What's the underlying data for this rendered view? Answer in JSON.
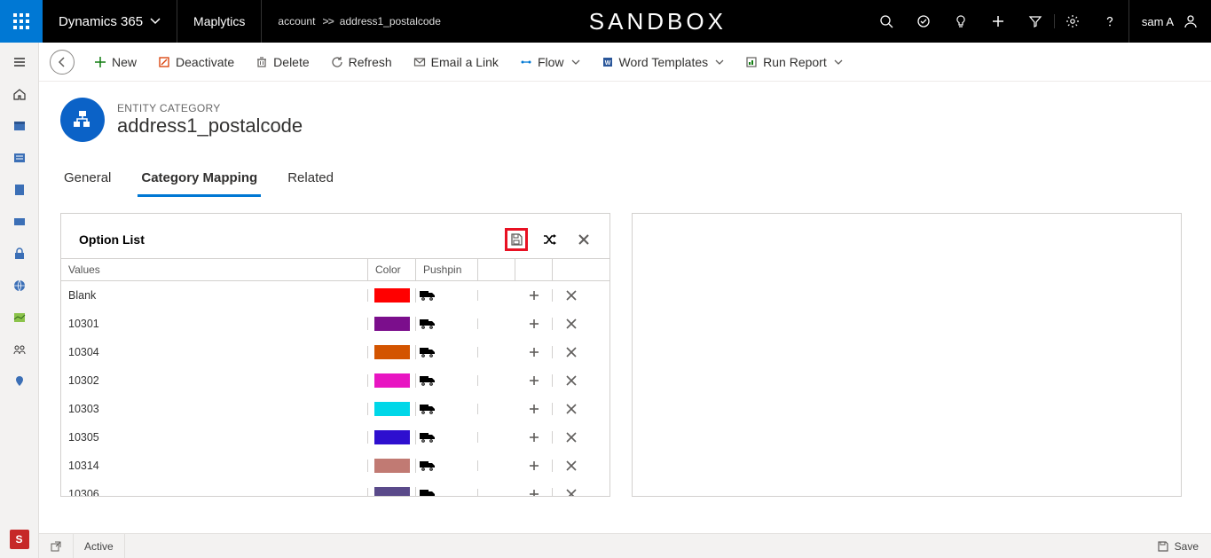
{
  "topbar": {
    "brand": "Dynamics 365",
    "app": "Maplytics",
    "breadcrumb": {
      "entity": "account",
      "field": "address1_postalcode"
    },
    "center": "SANDBOX",
    "user": "sam A"
  },
  "commands": {
    "new": "New",
    "deactivate": "Deactivate",
    "delete": "Delete",
    "refresh": "Refresh",
    "email": "Email a Link",
    "flow": "Flow",
    "word": "Word Templates",
    "report": "Run Report"
  },
  "page": {
    "category": "ENTITY CATEGORY",
    "title": "address1_postalcode"
  },
  "tabs": {
    "general": "General",
    "mapping": "Category Mapping",
    "related": "Related"
  },
  "optionlist": {
    "title": "Option List",
    "columns": {
      "values": "Values",
      "color": "Color",
      "pushpin": "Pushpin"
    },
    "rows": [
      {
        "value": "Blank",
        "color": "#ff0000"
      },
      {
        "value": "10301",
        "color": "#7b0e8c"
      },
      {
        "value": "10304",
        "color": "#d35400"
      },
      {
        "value": "10302",
        "color": "#e815c2"
      },
      {
        "value": "10303",
        "color": "#00d7e8"
      },
      {
        "value": "10305",
        "color": "#2e0fcf"
      },
      {
        "value": "10314",
        "color": "#c17a73"
      },
      {
        "value": "10306",
        "color": "#5a4a8a"
      }
    ]
  },
  "footer": {
    "status": "Active",
    "save": "Save"
  }
}
